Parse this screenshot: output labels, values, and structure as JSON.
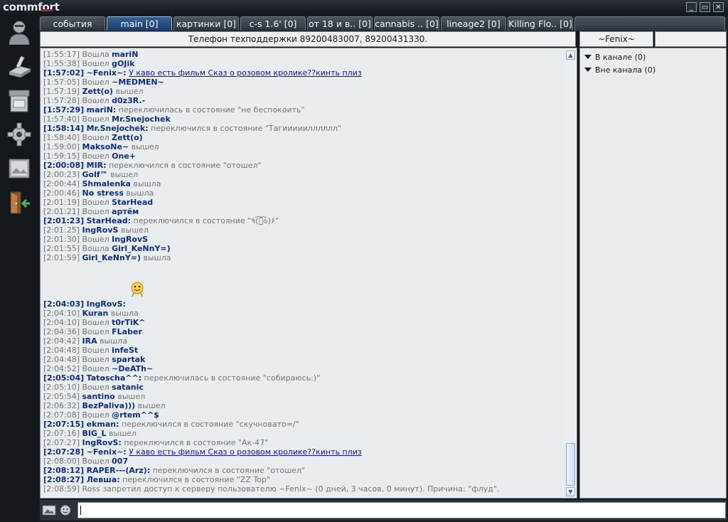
{
  "app": {
    "logo": "commfort"
  },
  "window_controls": {
    "minimize": "_",
    "maximize": "▭",
    "close": "✕"
  },
  "left_toolbar": [
    "profile-icon",
    "pen-icon",
    "printer-icon",
    "gear-icon",
    "image-icon",
    "exit-door-icon"
  ],
  "tabs": [
    {
      "label": "события"
    },
    {
      "label": "main [0]",
      "active": true
    },
    {
      "label": "картинки [0]"
    },
    {
      "label": "c-s 1.6' [0]"
    },
    {
      "label": "от 18 и в.. [0]"
    },
    {
      "label": "cannabis .. [0]"
    },
    {
      "label": "lineage2 [0]"
    },
    {
      "label": "Killing Flo.. [0]"
    }
  ],
  "topic": "Телефон техподдержки 89200483007, 89200431330.",
  "current_nick": "~Fenix~",
  "user_panel": {
    "groups": [
      "В канале (0)",
      "Вне канала (0)"
    ]
  },
  "chat": {
    "lines": [
      {
        "ts": "[1:55:17]",
        "pre": "Вошла ",
        "nick": "mariN",
        "post": ""
      },
      {
        "ts": "[1:55:38]",
        "pre": "Вошел ",
        "nick": "gOJik",
        "post": ""
      },
      {
        "ts": "[1:57:02]",
        "hl": true,
        "nick": "~Fenix~:",
        "link": "У каво есть фильм Сказ о розовом кролике??кинть плиз"
      },
      {
        "ts": "[1:57:05]",
        "pre": "Вошел ",
        "nick": "~MEDMEN~",
        "post": ""
      },
      {
        "ts": "[1:57:19]",
        "pre": "",
        "nick": "Zett(o)",
        "post": " вышел"
      },
      {
        "ts": "[1:57:28]",
        "pre": "Вошел ",
        "nick": "d0z3R.-",
        "post": ""
      },
      {
        "ts": "[1:57:29]",
        "hl": true,
        "nick": "mariN:",
        "post": " переключилась в состояние \"не беспокоить\""
      },
      {
        "ts": "[1:57:40]",
        "pre": "Вошел ",
        "nick": "Mr.Snejochek",
        "post": ""
      },
      {
        "ts": "[1:58:14]",
        "hl": true,
        "nick": "Mr.Snejochek:",
        "post": " переключился в состояние \"Тагииииилллллл\""
      },
      {
        "ts": "[1:58:40]",
        "pre": "Вошел ",
        "nick": "Zett(o)",
        "post": ""
      },
      {
        "ts": "[1:59:00]",
        "pre": "",
        "nick": "MaksoNe~",
        "post": " вышел"
      },
      {
        "ts": "[1:59:15]",
        "pre": "Вошел ",
        "nick": "One+",
        "post": ""
      },
      {
        "ts": "[2:00:08]",
        "hl": true,
        "nick": "MIR:",
        "post": " переключился в состояние \"отошел\""
      },
      {
        "ts": "[2:00:23]",
        "pre": "",
        "nick": "Golf™",
        "post": " вышел"
      },
      {
        "ts": "[2:00:44]",
        "pre": "",
        "nick": "Shmalenka",
        "post": " вышла"
      },
      {
        "ts": "[2:00:46]",
        "pre": "",
        "nick": "No stress",
        "post": " вышла"
      },
      {
        "ts": "[2:01:19]",
        "pre": "Вошел ",
        "nick": "StarHead",
        "post": ""
      },
      {
        "ts": "[2:01:21]",
        "pre": "Вошел ",
        "nick": "артём",
        "post": ""
      },
      {
        "ts": "[2:01:23]",
        "hl": true,
        "nick": "StarHead:",
        "post": " переключился в состояние \"٩(͡๏̯͡๏)۶\""
      },
      {
        "ts": "[2:01:25]",
        "pre": "",
        "nick": "IngRovS",
        "post": " вышел"
      },
      {
        "ts": "[2:01:30]",
        "pre": "Вошел ",
        "nick": "IngRovS",
        "post": ""
      },
      {
        "ts": "[2:01:55]",
        "pre": "Вошла ",
        "nick": "Girl_KeNnY=)",
        "post": ""
      },
      {
        "ts": "[2:01:59]",
        "pre": "",
        "nick": "Girl_KeNnY=)",
        "post": " вышла"
      },
      {
        "spacer": true
      },
      {
        "spacer": true
      },
      {
        "smiley": true
      },
      {
        "ts": "[2:04:03]",
        "hl": true,
        "nick": "IngRovS:",
        "post": ""
      },
      {
        "ts": "[2:04:10]",
        "pre": "",
        "nick": "Kuran",
        "post": " вышла"
      },
      {
        "ts": "[2:04:10]",
        "pre": "Вошел ",
        "nick": "t0rTiK^",
        "post": ""
      },
      {
        "ts": "[2:04:36]",
        "pre": "Вошел ",
        "nick": "FLaber",
        "post": ""
      },
      {
        "ts": "[2:04:42]",
        "pre": "",
        "nick": "IRA",
        "post": " вышла"
      },
      {
        "ts": "[2:04:48]",
        "pre": "Вошел ",
        "nick": "infeSt",
        "post": ""
      },
      {
        "ts": "[2:04:48]",
        "pre": "Вошел ",
        "nick": "spartak",
        "post": ""
      },
      {
        "ts": "[2:04:52]",
        "pre": "Вошел ",
        "nick": "~DeATh~",
        "post": ""
      },
      {
        "ts": "[2:05:04]",
        "hl": true,
        "nick": "Tatoscha^^:",
        "post": " переключилась в состояние \"собираюсь:)\""
      },
      {
        "ts": "[2:05:10]",
        "pre": "Вошел ",
        "nick": "satanic",
        "post": ""
      },
      {
        "ts": "[2:05:54]",
        "pre": "",
        "nick": "santino",
        "post": " вышел"
      },
      {
        "ts": "[2:06:32]",
        "pre": "",
        "nick": "BezPaliva)))",
        "post": " вышел"
      },
      {
        "ts": "[2:07:08]",
        "pre": "Вошел ",
        "nick": "@rtem^^$",
        "post": ""
      },
      {
        "ts": "[2:07:15]",
        "hl": true,
        "nick": "ekman:",
        "post": " переключился в состояние \"скучновато=/\""
      },
      {
        "ts": "[2:07:16]",
        "pre": "",
        "nick": "BIG_L",
        "post": " вышел"
      },
      {
        "ts": "[2:07:27]",
        "pre": "",
        "nick": "IngRovS:",
        "post": " переключился в состояние \"Ак-47\""
      },
      {
        "ts": "[2:07:28]",
        "hl": true,
        "nick": "~Fenix~:",
        "link": "У каво есть фильм Сказ о розовом кролике??кинть плиз"
      },
      {
        "ts": "[2:08:00]",
        "pre": "Вошел ",
        "nick": "007",
        "post": ""
      },
      {
        "ts": "[2:08:12]",
        "hl": true,
        "nick": "RAPER---(Arz):",
        "post": " переключился в состояние \"отошел\""
      },
      {
        "ts": "[2:08:27]",
        "hl": true,
        "nick": "Левша:",
        "post": " переключился в состояние \"ZZ Top\""
      },
      {
        "ts": "[2:08:59]",
        "pre": "Ross запретил доступ к серверу пользователю ~Fenix~ (0 дней, 3 часов, 0 минут). Причина: \"флуд\".",
        "nick": "",
        "post": ""
      }
    ]
  },
  "input": {
    "value": ""
  },
  "colors": {
    "chat_bg": "#eaedf0",
    "nick": "#0c2f85",
    "timestamp": "#757575",
    "link": "#1414b0",
    "tab_active": "#2b4f80"
  }
}
